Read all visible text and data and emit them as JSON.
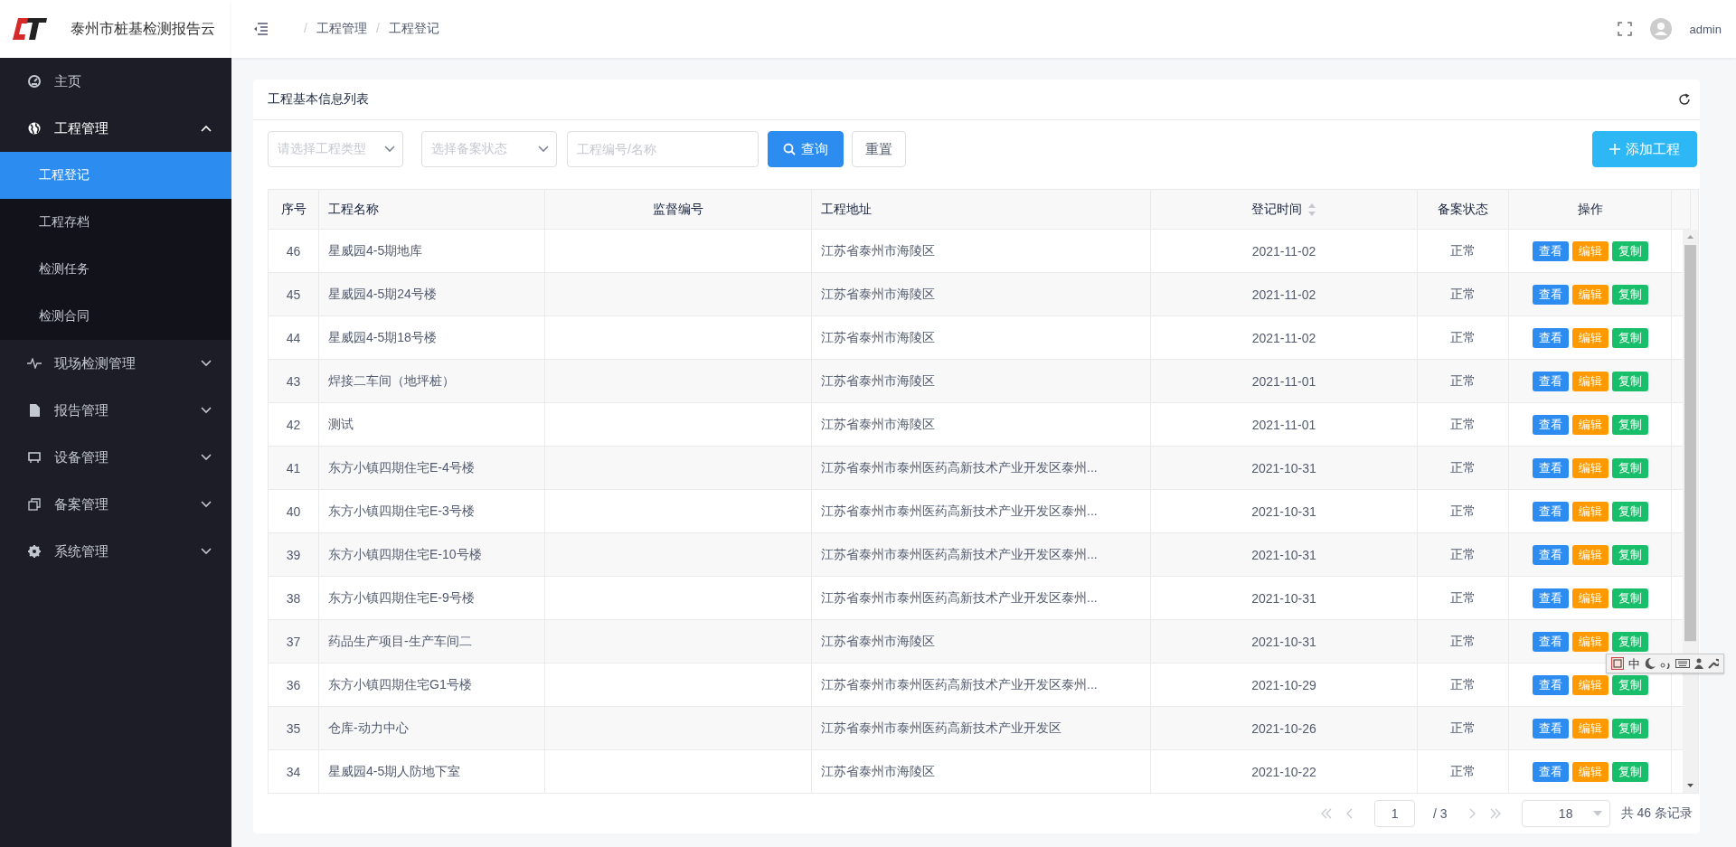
{
  "sidebar": {
    "title": "泰州市桩基检测报告云",
    "menu": [
      {
        "label": "主页",
        "kind": "link"
      },
      {
        "label": "工程管理",
        "kind": "group",
        "expanded": true,
        "children": [
          {
            "label": "工程登记",
            "selected": true
          },
          {
            "label": "工程存档",
            "selected": false
          },
          {
            "label": "检测任务",
            "selected": false
          },
          {
            "label": "检测合同",
            "selected": false
          }
        ]
      },
      {
        "label": "现场检测管理",
        "kind": "group",
        "expanded": false
      },
      {
        "label": "报告管理",
        "kind": "group",
        "expanded": false
      },
      {
        "label": "设备管理",
        "kind": "group",
        "expanded": false
      },
      {
        "label": "备案管理",
        "kind": "group",
        "expanded": false
      },
      {
        "label": "系统管理",
        "kind": "group",
        "expanded": false
      }
    ]
  },
  "header": {
    "breadcrumb": {
      "separator": "/",
      "items": [
        "工程管理",
        "工程登记"
      ]
    },
    "user": "admin"
  },
  "card": {
    "title": "工程基本信息列表",
    "filters": [
      {
        "kind": "select",
        "placeholder": "请选择工程类型"
      },
      {
        "kind": "select",
        "placeholder": "选择备案状态"
      },
      {
        "kind": "input",
        "placeholder": "工程编号/名称"
      }
    ],
    "search_button": "查询",
    "reset_button": "重置",
    "add_button": "添加工程"
  },
  "table": {
    "columns": [
      {
        "label": "序号",
        "sortable": false
      },
      {
        "label": "工程名称",
        "sortable": false
      },
      {
        "label": "监督编号",
        "sortable": false
      },
      {
        "label": "工程地址",
        "sortable": false
      },
      {
        "label": "登记时间",
        "sortable": true
      },
      {
        "label": "备案状态",
        "sortable": false
      },
      {
        "label": "操作",
        "sortable": false
      }
    ],
    "rows": [
      {
        "cells": [
          "46",
          "星威园4-5期地库",
          "",
          "江苏省泰州市海陵区",
          "2021-11-02",
          "正常"
        ],
        "actions": [
          {
            "label": "查看",
            "kind": "view"
          },
          {
            "label": "编辑",
            "kind": "edit"
          },
          {
            "label": "复制",
            "kind": "copy"
          }
        ]
      },
      {
        "cells": [
          "45",
          "星威园4-5期24号楼",
          "",
          "江苏省泰州市海陵区",
          "2021-11-02",
          "正常"
        ],
        "actions": [
          {
            "label": "查看",
            "kind": "view"
          },
          {
            "label": "编辑",
            "kind": "edit"
          },
          {
            "label": "复制",
            "kind": "copy"
          }
        ]
      },
      {
        "cells": [
          "44",
          "星威园4-5期18号楼",
          "",
          "江苏省泰州市海陵区",
          "2021-11-02",
          "正常"
        ],
        "actions": [
          {
            "label": "查看",
            "kind": "view"
          },
          {
            "label": "编辑",
            "kind": "edit"
          },
          {
            "label": "复制",
            "kind": "copy"
          }
        ]
      },
      {
        "cells": [
          "43",
          "焊接二车间（地坪桩）",
          "",
          "江苏省泰州市海陵区",
          "2021-11-01",
          "正常"
        ],
        "actions": [
          {
            "label": "查看",
            "kind": "view"
          },
          {
            "label": "编辑",
            "kind": "edit"
          },
          {
            "label": "复制",
            "kind": "copy"
          }
        ]
      },
      {
        "cells": [
          "42",
          "测试",
          "",
          "江苏省泰州市海陵区",
          "2021-11-01",
          "正常"
        ],
        "actions": [
          {
            "label": "查看",
            "kind": "view"
          },
          {
            "label": "编辑",
            "kind": "edit"
          },
          {
            "label": "复制",
            "kind": "copy"
          }
        ]
      },
      {
        "cells": [
          "41",
          "东方小镇四期住宅E-4号楼",
          "",
          "江苏省泰州市泰州医药高新技术产业开发区泰州...",
          "2021-10-31",
          "正常"
        ],
        "actions": [
          {
            "label": "查看",
            "kind": "view"
          },
          {
            "label": "编辑",
            "kind": "edit"
          },
          {
            "label": "复制",
            "kind": "copy"
          }
        ]
      },
      {
        "cells": [
          "40",
          "东方小镇四期住宅E-3号楼",
          "",
          "江苏省泰州市泰州医药高新技术产业开发区泰州...",
          "2021-10-31",
          "正常"
        ],
        "actions": [
          {
            "label": "查看",
            "kind": "view"
          },
          {
            "label": "编辑",
            "kind": "edit"
          },
          {
            "label": "复制",
            "kind": "copy"
          }
        ]
      },
      {
        "cells": [
          "39",
          "东方小镇四期住宅E-10号楼",
          "",
          "江苏省泰州市泰州医药高新技术产业开发区泰州...",
          "2021-10-31",
          "正常"
        ],
        "actions": [
          {
            "label": "查看",
            "kind": "view"
          },
          {
            "label": "编辑",
            "kind": "edit"
          },
          {
            "label": "复制",
            "kind": "copy"
          }
        ]
      },
      {
        "cells": [
          "38",
          "东方小镇四期住宅E-9号楼",
          "",
          "江苏省泰州市泰州医药高新技术产业开发区泰州...",
          "2021-10-31",
          "正常"
        ],
        "actions": [
          {
            "label": "查看",
            "kind": "view"
          },
          {
            "label": "编辑",
            "kind": "edit"
          },
          {
            "label": "复制",
            "kind": "copy"
          }
        ]
      },
      {
        "cells": [
          "37",
          "药品生产项目-生产车间二",
          "",
          "江苏省泰州市海陵区",
          "2021-10-31",
          "正常"
        ],
        "actions": [
          {
            "label": "查看",
            "kind": "view"
          },
          {
            "label": "编辑",
            "kind": "edit"
          },
          {
            "label": "复制",
            "kind": "copy"
          }
        ]
      },
      {
        "cells": [
          "36",
          "东方小镇四期住宅G1号楼",
          "",
          "江苏省泰州市泰州医药高新技术产业开发区泰州...",
          "2021-10-29",
          "正常"
        ],
        "actions": [
          {
            "label": "查看",
            "kind": "view"
          },
          {
            "label": "编辑",
            "kind": "edit"
          },
          {
            "label": "复制",
            "kind": "copy"
          }
        ]
      },
      {
        "cells": [
          "35",
          "仓库-动力中心",
          "",
          "江苏省泰州市泰州医药高新技术产业开发区",
          "2021-10-26",
          "正常"
        ],
        "actions": [
          {
            "label": "查看",
            "kind": "view"
          },
          {
            "label": "编辑",
            "kind": "edit"
          },
          {
            "label": "复制",
            "kind": "copy"
          }
        ]
      },
      {
        "cells": [
          "34",
          "星威园4-5期人防地下室",
          "",
          "江苏省泰州市海陵区",
          "2021-10-22",
          "正常"
        ],
        "actions": [
          {
            "label": "查看",
            "kind": "view"
          },
          {
            "label": "编辑",
            "kind": "edit"
          },
          {
            "label": "复制",
            "kind": "copy"
          }
        ]
      }
    ]
  },
  "pagination": {
    "page": "1",
    "total_pages": "/ 3",
    "page_size": "18",
    "summary": "共 46 条记录"
  },
  "ime_bar": {
    "mode": "中"
  }
}
